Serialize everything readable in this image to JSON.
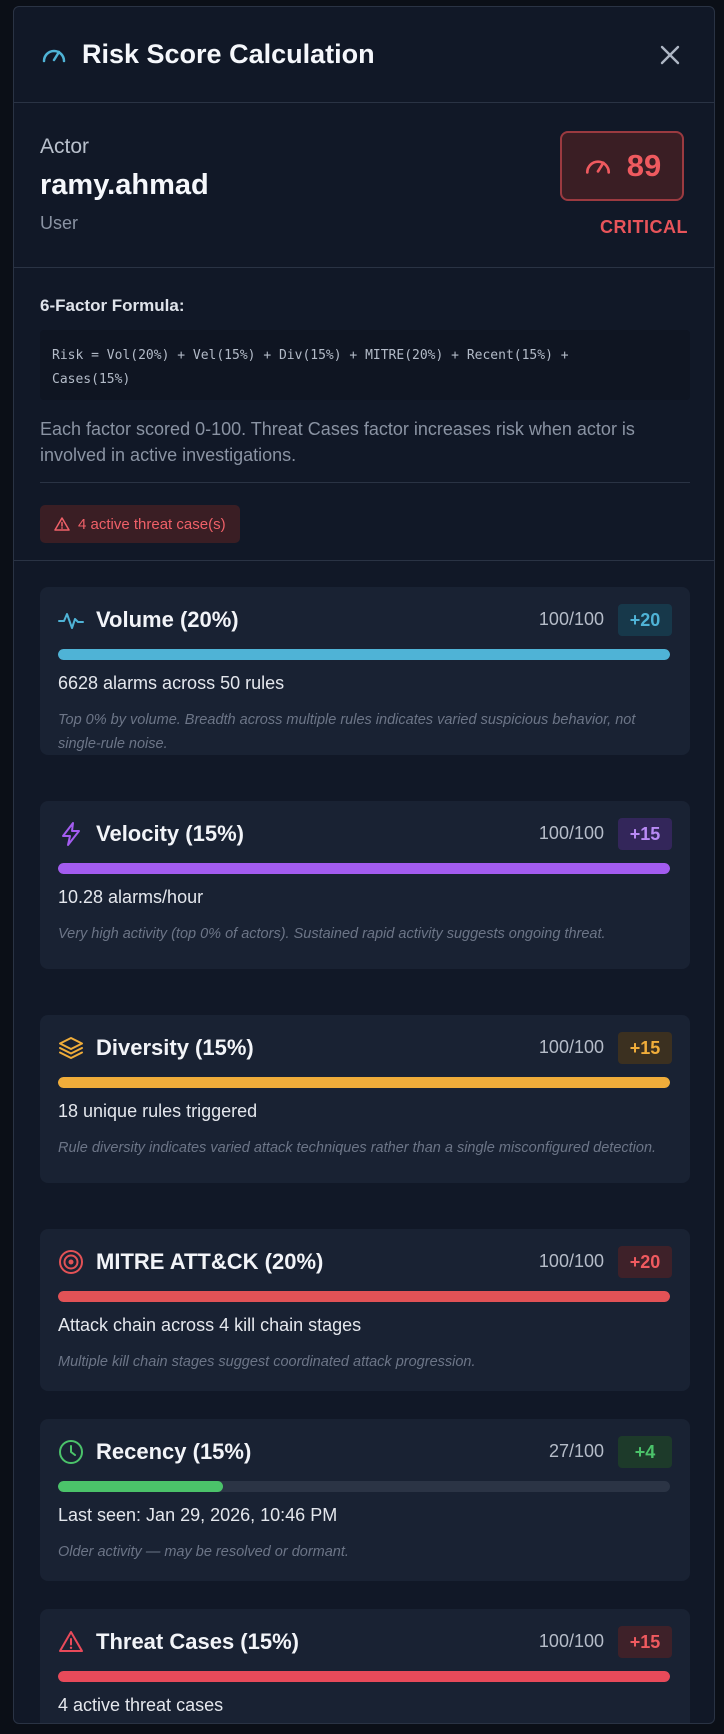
{
  "header": {
    "title": "Risk Score Calculation",
    "icon": "gauge-icon",
    "close": "close-icon"
  },
  "actor": {
    "label": "Actor",
    "name": "ramy.ahmad",
    "type": "User",
    "score": "89",
    "severity": "CRITICAL"
  },
  "formula": {
    "title": "6-Factor Formula:",
    "line1": "Risk = Vol(20%) + Vel(15%) + Div(15%) + MITRE(20%) + Recent(15%) +",
    "line2": "Cases(15%)",
    "description": "Each factor scored 0-100. Threat Cases factor increases risk when actor is involved in active investigations.",
    "threat_badge": "4 active threat case(s)"
  },
  "factors": [
    {
      "name": "Volume (20%)",
      "score": "100/100",
      "delta": "+20",
      "fill": 1.0,
      "metric": "6628 alarms across 50 rules",
      "note": "Top 0% by volume. Breadth across multiple rules indicates varied suspicious behavior, not single-rule noise.",
      "color": "#4fb3d6",
      "delta_bg": "#17384a",
      "icon": "activity-icon"
    },
    {
      "name": "Velocity (15%)",
      "score": "100/100",
      "delta": "+15",
      "fill": 1.0,
      "metric": "10.28 alarms/hour",
      "note": "Very high activity (top 0% of actors). Sustained rapid activity suggests ongoing threat.",
      "color": "#a35cf0",
      "delta_bg": "#33265a",
      "icon": "lightning-icon"
    },
    {
      "name": "Diversity (15%)",
      "score": "100/100",
      "delta": "+15",
      "fill": 1.0,
      "metric": "18 unique rules triggered",
      "note": "Rule diversity indicates varied attack techniques rather than a single misconfigured detection.",
      "color": "#f0ad3a",
      "delta_bg": "#3b3020",
      "icon": "layers-icon"
    },
    {
      "name": "MITRE ATT&CK (20%)",
      "score": "100/100",
      "delta": "+20",
      "fill": 1.0,
      "metric": "Attack chain across 4 kill chain stages",
      "note": "Multiple kill chain stages suggest coordinated attack progression.",
      "color": "#e25256",
      "delta_bg": "#3e2129",
      "icon": "target-icon"
    },
    {
      "name": "Recency (15%)",
      "score": "27/100",
      "delta": "+4",
      "fill": 0.27,
      "metric": "Last seen: Jan 29, 2026, 10:46 PM",
      "note": "Older activity — may be resolved or dormant.",
      "color": "#4bc36a",
      "delta_bg": "#1d3a2a",
      "icon": "clock-icon"
    },
    {
      "name": "Threat Cases (15%)",
      "score": "100/100",
      "delta": "+15",
      "fill": 1.0,
      "metric": "4 active threat cases",
      "note": "",
      "color": "#e84a5a",
      "delta_bg": "#3e2129",
      "icon": "warning-icon"
    }
  ]
}
